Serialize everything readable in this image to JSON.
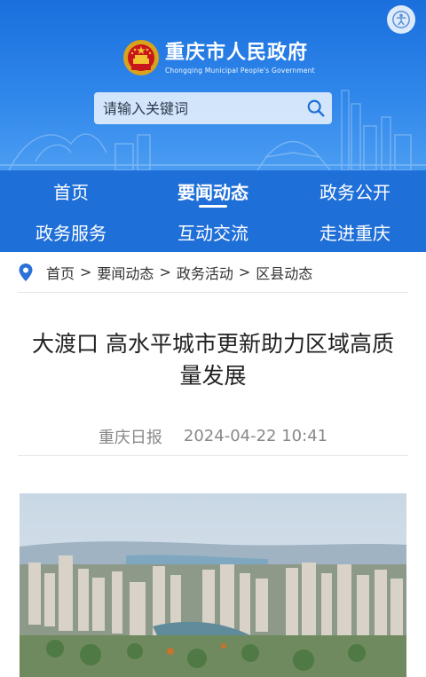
{
  "header": {
    "logo_cn": "重庆市人民政府",
    "logo_en": "Chongqing Municipal People's Government",
    "brand_color": "#1a6fdc"
  },
  "search": {
    "placeholder": "请输入关键词"
  },
  "nav": {
    "items": [
      {
        "label": "首页"
      },
      {
        "label": "要闻动态"
      },
      {
        "label": "政务公开"
      },
      {
        "label": "政务服务"
      },
      {
        "label": "互动交流"
      },
      {
        "label": "走进重庆"
      }
    ],
    "active_label": "要闻动态"
  },
  "breadcrumb": {
    "items": [
      "首页",
      "要闻动态",
      "政务活动",
      "区县动态"
    ],
    "separator": ">"
  },
  "article": {
    "title": "大渡口 高水平城市更新助力区域高质量发展",
    "source": "重庆日报",
    "date": "2024-04-22 10:41"
  }
}
